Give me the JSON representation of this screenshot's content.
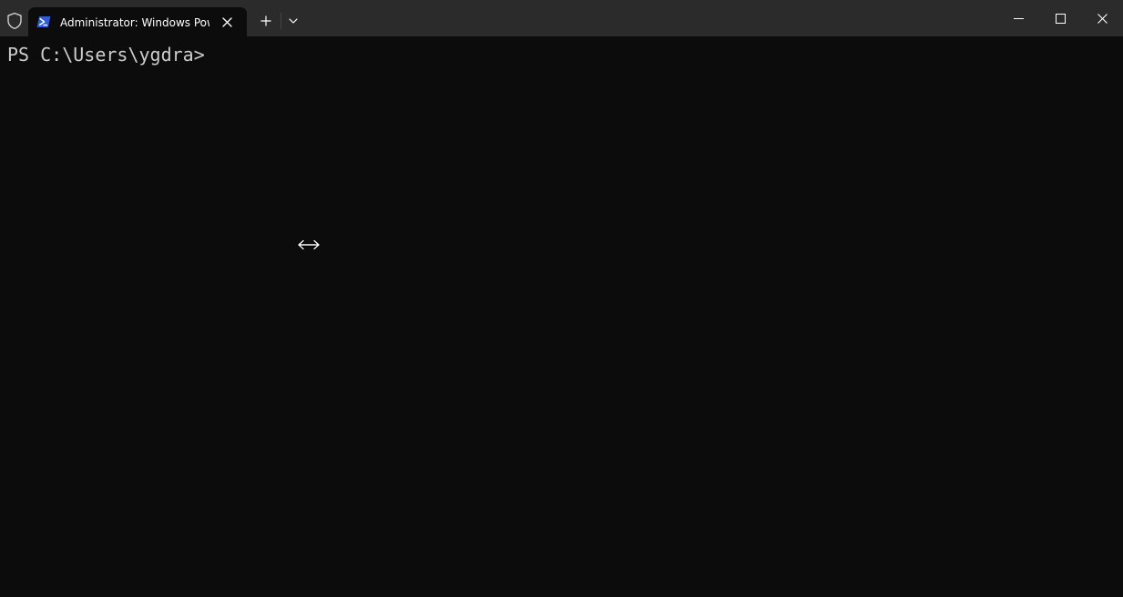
{
  "titlebar": {
    "tab_title": "Administrator: Windows PowerShell",
    "shield_icon": "shield-icon",
    "tab_icon": "powershell-icon",
    "new_tab_icon": "plus-icon",
    "dropdown_icon": "chevron-down-icon",
    "window_controls": [
      "minimize-icon",
      "maximize-icon",
      "close-icon"
    ]
  },
  "terminal": {
    "prompt": "PS C:\\Users\\ygdra>"
  },
  "colors": {
    "titlebar_bg": "#2b2b2b",
    "terminal_bg": "#0c0c0c",
    "terminal_fg": "#cccccc",
    "powershell_blue": "#2c5ee0"
  }
}
